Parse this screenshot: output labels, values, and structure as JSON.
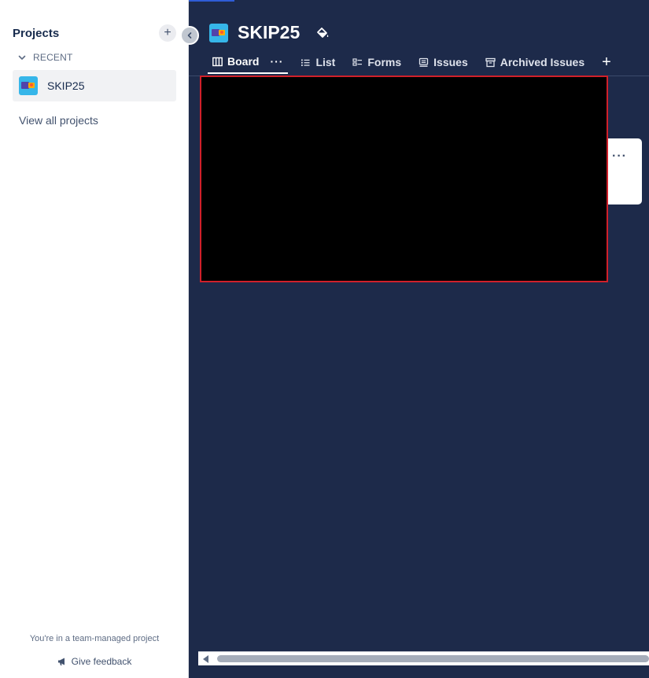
{
  "sidebar": {
    "title": "Projects",
    "add_label": "+",
    "recent_label": "RECENT",
    "items": [
      {
        "label": "SKIP25"
      }
    ],
    "view_all": "View all projects",
    "footer_note": "You're in a team-managed project",
    "feedback": "Give feedback"
  },
  "header": {
    "project_name": "SKIP25"
  },
  "tabs": [
    {
      "label": "Board",
      "more": "···"
    },
    {
      "label": "List"
    },
    {
      "label": "Forms"
    },
    {
      "label": "Issues"
    },
    {
      "label": "Archived Issues"
    }
  ],
  "tab_add_label": "+",
  "card": {
    "more": "···"
  },
  "colors": {
    "background": "#1d2a4a",
    "sidebar": "#ffffff",
    "project_icon": "#36b6e9",
    "accent_line": "#2f5cd6",
    "redaction_border": "#d0202a"
  }
}
